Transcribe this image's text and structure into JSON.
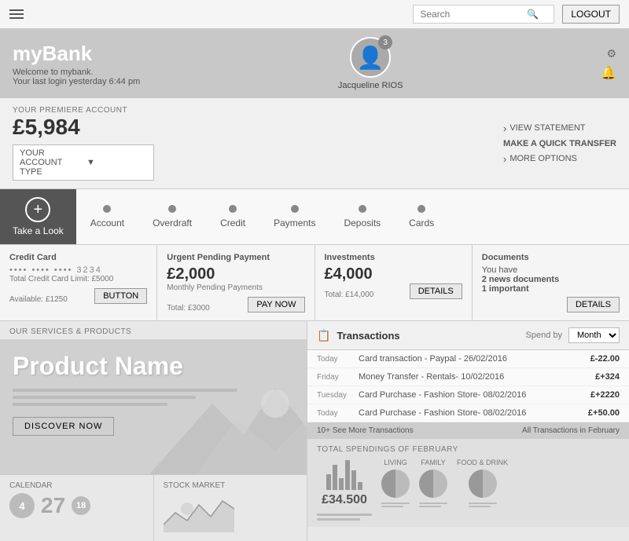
{
  "topbar": {
    "search_placeholder": "Search",
    "logout_label": "LOGOUT"
  },
  "header": {
    "brand": "myBank",
    "welcome": "Welcome to mybank.",
    "last_login": "Your last login yesterday 6:44 pm",
    "avatar_badge": "3",
    "avatar_name": "Jacqueline RIOS"
  },
  "account": {
    "label": "YOUR PREMIERE ACCOUNT",
    "balance": "£5,984",
    "type_placeholder": "YOUR ACCOUNT TYPE",
    "view_statement": "VIEW STATEMENT",
    "quick_transfer": "MAKE A QUICK TRANSFER",
    "more_options": "MORE OPTIONS"
  },
  "tabs": {
    "take_look": "Take a Look",
    "items": [
      {
        "label": "Account"
      },
      {
        "label": "Overdraft"
      },
      {
        "label": "Credit"
      },
      {
        "label": "Payments"
      },
      {
        "label": "Deposits"
      },
      {
        "label": "Cards"
      }
    ]
  },
  "summary": {
    "credit_card": {
      "title": "Credit Card",
      "number": "•••• •••• •••• 3234",
      "limit": "Total Credit Card Limit: £5000",
      "available": "Available: £1250",
      "btn": "BUTTON"
    },
    "pending": {
      "title": "Urgent Pending Payment",
      "amount": "£2,000",
      "sub": "Monthly Pending Payments",
      "total": "Total: £3000",
      "btn": "PAY NOW"
    },
    "investments": {
      "title": "Investments",
      "amount": "£4,000",
      "total": "Total: £14,000",
      "btn": "DETAILS"
    },
    "documents": {
      "title": "Documents",
      "line1": "You have",
      "line2": "2 news documents",
      "line3": "1 important",
      "btn": "DETAILS"
    }
  },
  "services": {
    "header": "OUR SERVICES & PRODUCTS",
    "product_name": "Product Name",
    "discover_btn": "DISCOVER NOW"
  },
  "transactions": {
    "title": "Transactions",
    "spend_by": "Spend by",
    "month": "Month",
    "items": [
      {
        "day": "Today",
        "desc": "Card transaction - Paypal - 26/02/2016",
        "amount": "£-22.00"
      },
      {
        "day": "Friday",
        "desc": "Money Transfer - Rentals- 10/02/2016",
        "amount": "£+324"
      },
      {
        "day": "Tuesday",
        "desc": "Card Purchase - Fashion Store- 08/02/2016",
        "amount": "£+2220"
      },
      {
        "day": "Today",
        "desc": "Card Purchase - Fashion Store- 08/02/2016",
        "amount": "£+50.00"
      }
    ],
    "see_more": "10+ See More Transactions",
    "all_february": "All Transactions in February"
  },
  "spending": {
    "title": "TOTAL SPENDINGS OF FEBRUARY",
    "amount": "£34.500",
    "categories": [
      {
        "label": "LIVING"
      },
      {
        "label": "FAMILY"
      },
      {
        "label": "FOOD & DRINK"
      }
    ]
  },
  "bottom": {
    "calendar_label": "CALENDAR",
    "stock_label": "STOCK MARKET",
    "calendar_nums": [
      "4",
      "27",
      "18"
    ]
  }
}
